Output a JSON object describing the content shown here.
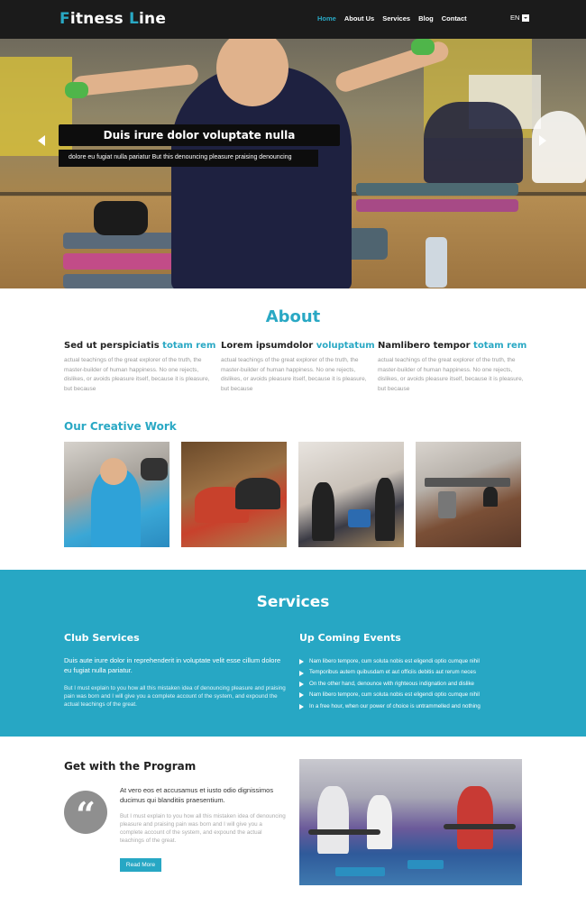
{
  "brand": {
    "first_cap": "F",
    "first_rest": "itness ",
    "second_cap": "L",
    "second_rest": "ine",
    "accent": "#29a8c4"
  },
  "nav": {
    "items": [
      {
        "label": "Home",
        "active": true
      },
      {
        "label": "About Us",
        "active": false
      },
      {
        "label": "Services",
        "active": false
      },
      {
        "label": "Blog",
        "active": false
      },
      {
        "label": "Contact",
        "active": false
      }
    ],
    "language": "EN",
    "language_icon": "dropdown-icon"
  },
  "hero": {
    "title": "Duis irure dolor voluptate nulla",
    "subtitle": "dolore eu fugiat nulla pariatur But this denouncing pleasure praising denouncing",
    "prev_icon": "arrow-left-icon",
    "next_icon": "arrow-right-icon"
  },
  "about": {
    "title": "About",
    "columns": [
      {
        "heading": "Sed ut perspiciatis ",
        "heading_accent": "totam rem",
        "text": "actual teachings of the great explorer of the truth, the master-builder of human happiness. No one rejects, dislikes, or avoids pleasure itself, because it is pleasure, but because"
      },
      {
        "heading": "Lorem ipsumdolor ",
        "heading_accent": "voluptatum",
        "text": "actual teachings of the great explorer of the truth, the master-builder of human happiness. No one rejects, dislikes, or avoids pleasure itself, because it is pleasure, but because"
      },
      {
        "heading": "Namlibero tempor ",
        "heading_accent": "totam rem",
        "text": "actual teachings of the great explorer of the truth, the master-builder of human happiness. No one rejects, dislikes, or avoids pleasure itself, because it is pleasure, but because"
      }
    ]
  },
  "work": {
    "title": "Our Creative Work"
  },
  "services": {
    "title": "Services",
    "club": {
      "heading": "Club Services",
      "lead": "Duis aute irure dolor in reprehenderit in voluptate velit esse cillum dolore eu fugiat nulla pariatur.",
      "body": "But I must explain to you how all this mistaken idea of denouncing pleasure and praising pain was born and I will give you a complete account of the system, and expound the actual teachings of the great."
    },
    "events": {
      "heading": "Up Coming Events",
      "items": [
        "Nam libero tempore, cum soluta nobis est eligendi optio cumque nihil",
        "Temporibus autem quibusdam et aut officiis debitis aut rerum neces",
        "On the other hand, denounce with righteous indignation and dislike",
        "Nam libero tempore, cum soluta nobis est eligendi optio cumque nihil",
        "In a free hour, when our power of choice is untrammelled and nothing"
      ]
    }
  },
  "program": {
    "title": "Get with the Program",
    "quote_icon": "quote-icon",
    "lead": "At vero eos et accusamus et iusto odio dignissimos ducimus qui blanditiis praesentium.",
    "body": "But I must explain to you how all this mistaken idea of denouncing pleasure and praising pain was born and I will give you a complete account of the system, and expound the actual teachings of the great.",
    "button": "Read More"
  }
}
